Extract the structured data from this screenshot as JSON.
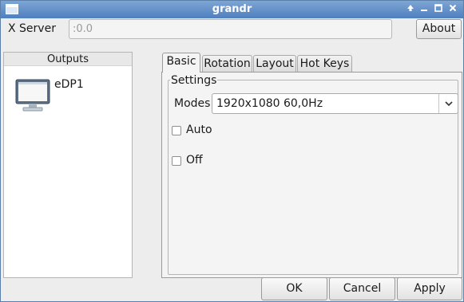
{
  "window": {
    "title": "grandr"
  },
  "xserver": {
    "label": "X Server",
    "value": ":0.0"
  },
  "about_label": "About",
  "outputs": {
    "header": "Outputs",
    "items": [
      {
        "name": "eDP1",
        "icon": "monitor-icon"
      }
    ]
  },
  "tabs": [
    {
      "label": "Basic",
      "active": true
    },
    {
      "label": "Rotation"
    },
    {
      "label": "Layout"
    },
    {
      "label": "Hot Keys"
    }
  ],
  "settings": {
    "legend": "Settings",
    "modes_label": "Modes",
    "modes_value": "1920x1080  60,0Hz",
    "auto_label": "Auto",
    "auto_checked": false,
    "off_label": "Off",
    "off_checked": false
  },
  "buttons": {
    "ok": "OK",
    "cancel": "Cancel",
    "apply": "Apply"
  },
  "colors": {
    "titlebar": "#5b88c4",
    "accent": "#4a90d9"
  }
}
